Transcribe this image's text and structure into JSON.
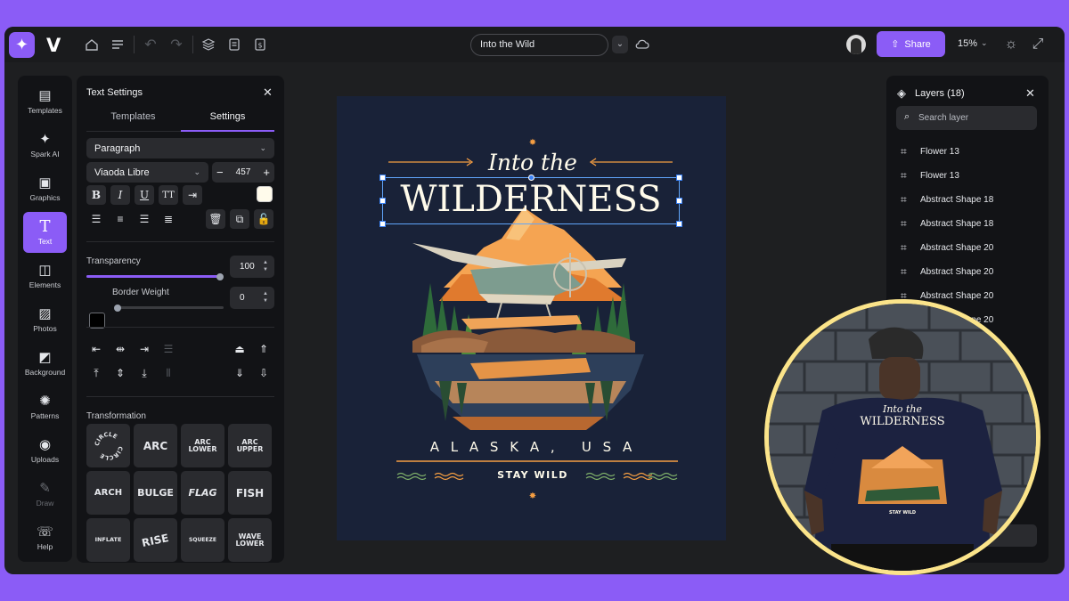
{
  "topbar": {
    "brand": "V",
    "document_title": "Into the Wild",
    "share_label": "Share",
    "zoom": "15%"
  },
  "rail": [
    {
      "label": "Templates",
      "icon": "templates-icon"
    },
    {
      "label": "Spark AI",
      "icon": "spark-icon"
    },
    {
      "label": "Graphics",
      "icon": "graphics-icon"
    },
    {
      "label": "Text",
      "icon": "text-icon"
    },
    {
      "label": "Elements",
      "icon": "elements-icon"
    },
    {
      "label": "Photos",
      "icon": "photos-icon"
    },
    {
      "label": "Background",
      "icon": "background-icon"
    },
    {
      "label": "Patterns",
      "icon": "patterns-icon"
    },
    {
      "label": "Uploads",
      "icon": "uploads-icon"
    },
    {
      "label": "Draw",
      "icon": "draw-icon"
    },
    {
      "label": "Help",
      "icon": "help-icon"
    }
  ],
  "text_settings": {
    "title": "Text Settings",
    "tabs": [
      "Templates",
      "Settings"
    ],
    "active_tab": "Settings",
    "style_select": "Paragraph",
    "font_select": "Viaoda Libre",
    "font_size": "457",
    "text_color": "#fffbeb",
    "transparency_label": "Transparency",
    "transparency_value": "100",
    "border_weight_label": "Border Weight",
    "border_weight_value": "0",
    "transformation_label": "Transformation",
    "transformations": [
      "CIRCLE",
      "ARC",
      "ARC LOWER",
      "ARC UPPER",
      "ARCH",
      "BULGE",
      "FLAG",
      "FISH",
      "INFLATE",
      "RISE",
      "SQUEEZE",
      "WAVE LOWER"
    ]
  },
  "design": {
    "headline_small": "Into the",
    "headline_big": "WILDERNESS",
    "location": "A L A S K A ,   U S A",
    "tagline": "STAY WILD"
  },
  "shirt_print": {
    "headline_small": "Into the",
    "headline_big": "WILDERNESS",
    "tagline": "STAY WILD"
  },
  "layers": {
    "title": "Layers (18)",
    "search_placeholder": "Search layer",
    "items": [
      "Flower 13",
      "Flower 13",
      "Abstract Shape 18",
      "Abstract Shape 18",
      "Abstract Shape 20",
      "Abstract Shape 20",
      "Abstract Shape 20",
      "Abstract Shape 20"
    ]
  },
  "colors": {
    "accent": "#8b5cf6",
    "canvas_bg": "#192238",
    "design_orange": "#f59e42",
    "inset_border": "#fbe48a"
  }
}
